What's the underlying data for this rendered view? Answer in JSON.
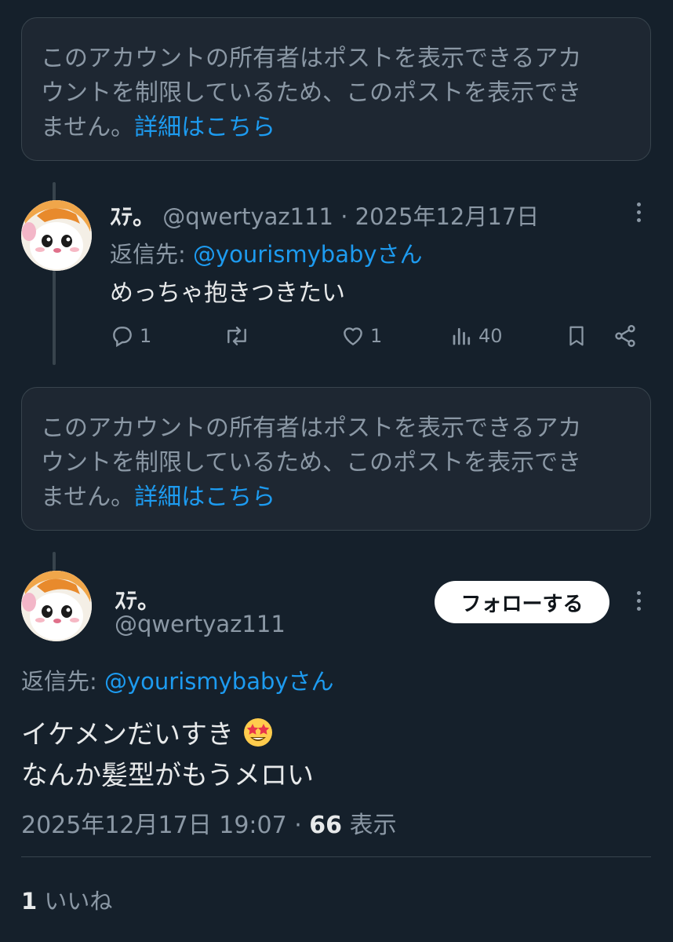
{
  "notice": {
    "lines": [
      "このアカウントの所有者はポストを表示できるアカ",
      "ウントを制限しているため、このポストを表示でき",
      "ません。"
    ],
    "link": "詳細はこちら"
  },
  "reply_tweet": {
    "display_name": "ｽﾃ。",
    "handle_date": "@qwertyaz111 · 2025年12月17日",
    "reply_prefix": "返信先: ",
    "reply_to": "@yourismybabyさん",
    "text": "めっちゃ抱きつきたい",
    "reply_count": "1",
    "like_count": "1",
    "view_count": "40"
  },
  "main_tweet": {
    "display_name": "ｽﾃ。",
    "handle": "@qwertyaz111",
    "follow_label": "フォローする",
    "reply_prefix": "返信先: ",
    "reply_to": "@yourismybabyさん",
    "line1": "イケメンだいすき",
    "line2": "なんか髪型がもうメロい",
    "timestamp": "2025年12月17日 19:07 · ",
    "views_count": "66",
    "views_label": " 表示",
    "likes_count": "1",
    "likes_label": " いいね"
  },
  "icons": [
    "reply-icon",
    "retweet-icon",
    "like-icon",
    "views-icon",
    "bookmark-icon",
    "share-icon",
    "more-icon",
    "star-struck-emoji"
  ],
  "colors": {
    "background": "#15202b",
    "accent": "#1d9bf0",
    "muted": "#8b98a5",
    "text": "#e7e9ea",
    "border": "#38444d"
  }
}
